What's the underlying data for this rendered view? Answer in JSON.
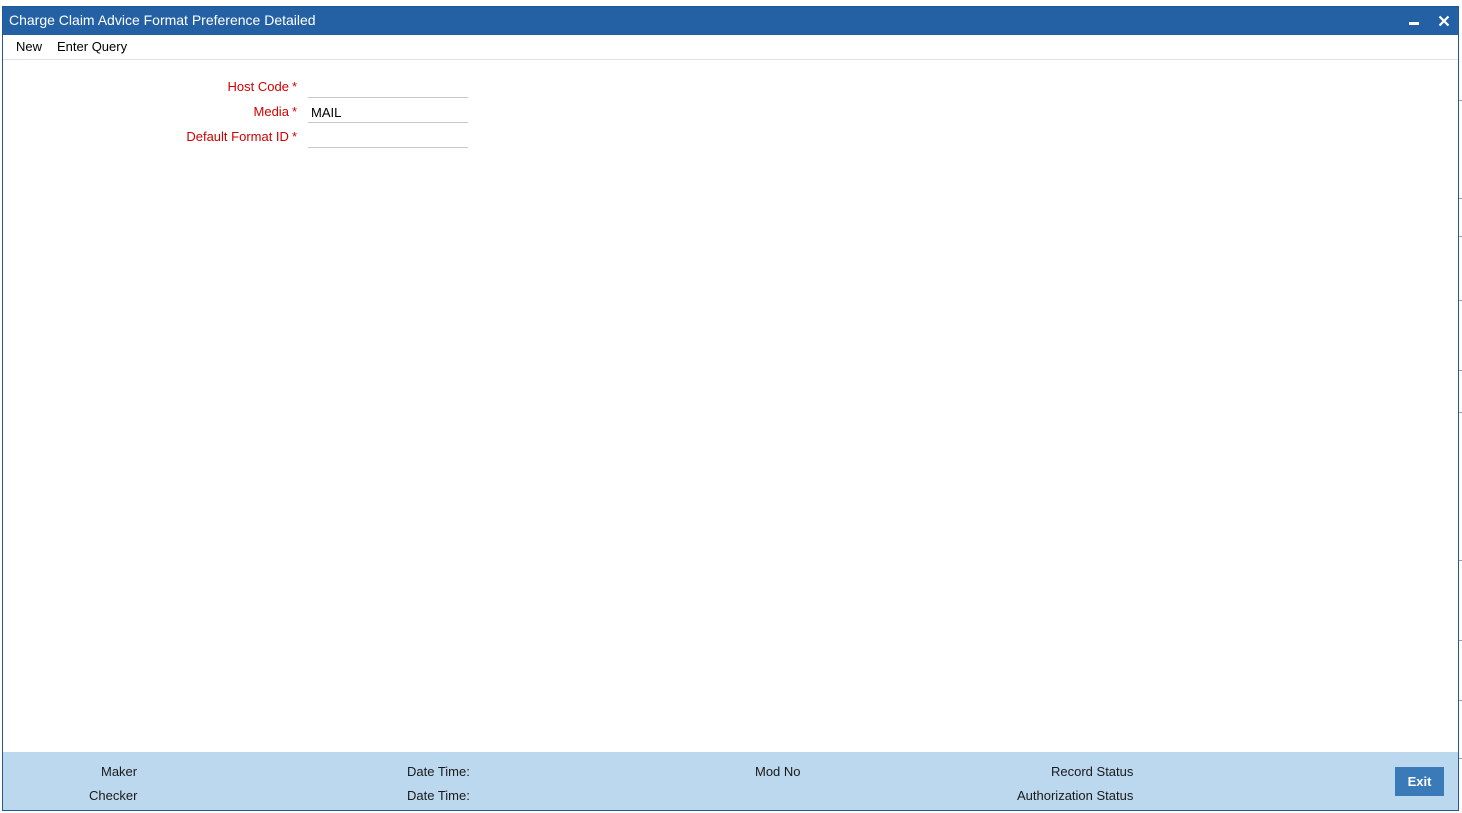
{
  "window": {
    "title": "Charge Claim Advice Format Preference Detailed",
    "colors": {
      "titlebar": "#2461a4",
      "footer": "#bcd8ee",
      "required_label": "#d10000",
      "exit_button": "#3b7ab8"
    }
  },
  "menu": {
    "new_label": "New",
    "enter_query_label": "Enter Query"
  },
  "form": {
    "host_code": {
      "label": "Host Code",
      "required": "*",
      "value": ""
    },
    "media": {
      "label": "Media",
      "required": "*",
      "value": "MAIL"
    },
    "default_format_id": {
      "label": "Default Format ID",
      "required": "*",
      "value": ""
    }
  },
  "footer": {
    "maker_label": "Maker",
    "checker_label": "Checker",
    "maker_datetime_label": "Date Time:",
    "checker_datetime_label": "Date Time:",
    "mod_no_label": "Mod No",
    "record_status_label": "Record Status",
    "authorization_status_label": "Authorization Status",
    "exit_label": "Exit"
  }
}
